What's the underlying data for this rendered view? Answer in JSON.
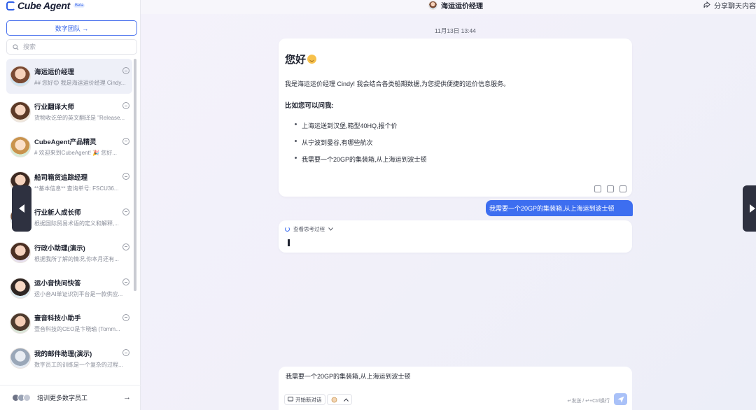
{
  "app": {
    "name": "Cube Agent",
    "badge": "Beta"
  },
  "sidebar": {
    "team_button": "数字团队 →",
    "search_placeholder": "搜索",
    "items": [
      {
        "name": "海运运价经理",
        "preview": "## 您好😊 我是海运运价经理 Cindy...",
        "active": true
      },
      {
        "name": "行业翻译大师",
        "preview": "货物收讫单的英文翻译是 \"Release..."
      },
      {
        "name": "CubeAgent产品精灵",
        "preview": "# 欢迎来到CubeAgent! 🎉 您好..."
      },
      {
        "name": "船司箱货追踪经理",
        "preview": "**基本信息** 查询单号: FSCU36..."
      },
      {
        "name": "行业新人成长师",
        "preview": "根据国际贸易术语的定义和解释,..."
      },
      {
        "name": "行政小助理(演示)",
        "preview": "根据我所了解的情况,你本月还有..."
      },
      {
        "name": "运小音快问快答",
        "preview": "运小音AI单证识别平台是一款供应..."
      },
      {
        "name": "壹音科技小助手",
        "preview": "壹音科技的CEO是卞晓瑜 (Tomm..."
      },
      {
        "name": "我的邮件助理(演示)",
        "preview": "数字员工的训练是一个复杂的过程..."
      }
    ],
    "footer_text": "培训更多数字员工",
    "footer_arrow": "→"
  },
  "header": {
    "chat_title": "海运运价经理",
    "share": "分享聊天内容"
  },
  "conversation": {
    "timestamp": "11月13日 13:44",
    "greeting": "您好",
    "intro": "我是海运运价经理 Cindy! 我会结合各类船期数据,为您提供便捷的运价信息服务。",
    "ask_heading": "比如您可以问我:",
    "questions": [
      "上海运送到汉堡,箱型40HQ,报个价",
      "从宁波到曼谷,有哪些航次",
      "我需要一个20GP的集装箱,从上海运到波士顿"
    ],
    "user_message": "我需要一个20GP的集装箱,从上海运到波士顿",
    "thinking_label": "查看思考过程"
  },
  "composer": {
    "text": "我需要一个20GP的集装箱,从上海运到波士顿",
    "new_chat": "开始新对话",
    "hint": "↵发送 / ↵+Ctrl换行",
    "send_icon": "paper-plane-icon"
  },
  "colors": {
    "accent": "#3d6ef0",
    "send_disabled": "#a9c1f8",
    "edge_tab": "#2e3140"
  }
}
